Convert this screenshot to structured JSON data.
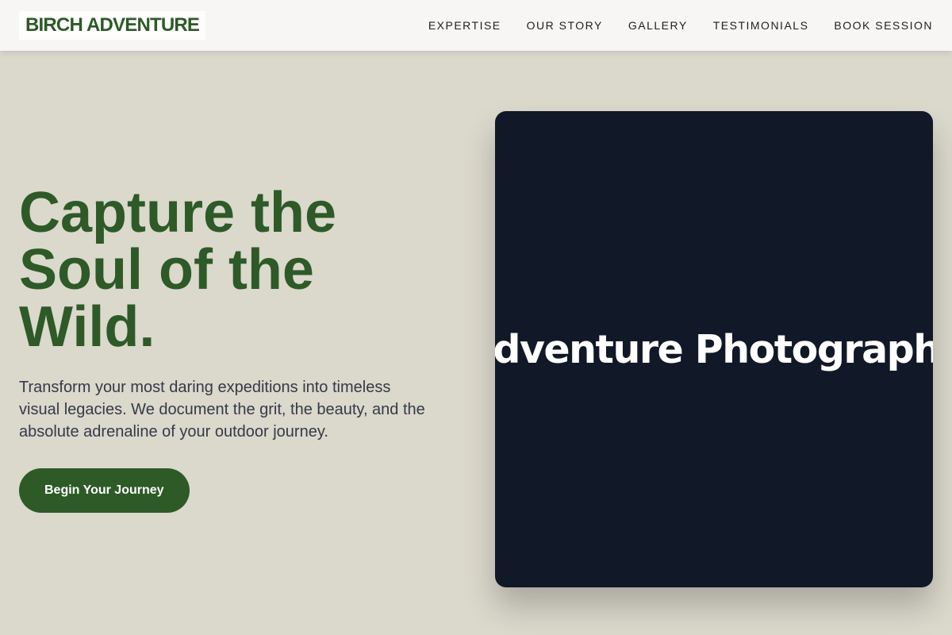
{
  "header": {
    "logo": "BIRCH ADVENTURE",
    "nav": [
      {
        "label": "EXPERTISE"
      },
      {
        "label": "OUR STORY"
      },
      {
        "label": "GALLERY"
      },
      {
        "label": "TESTIMONIALS"
      },
      {
        "label": "BOOK SESSION"
      }
    ]
  },
  "hero": {
    "title": "Capture the Soul of the Wild.",
    "subtitle": "Transform your most daring expeditions into timeless visual legacies. We document the grit, the beauty, and the absolute adrenaline of your outdoor journey.",
    "cta_label": "Begin Your Journey"
  },
  "photo": {
    "label": "Adventure Photography"
  },
  "colors": {
    "brand_green": "#2d5a27",
    "page_background": "#dbd8cc",
    "card_background": "#111827",
    "navbar_background": "#f7f6f4"
  }
}
